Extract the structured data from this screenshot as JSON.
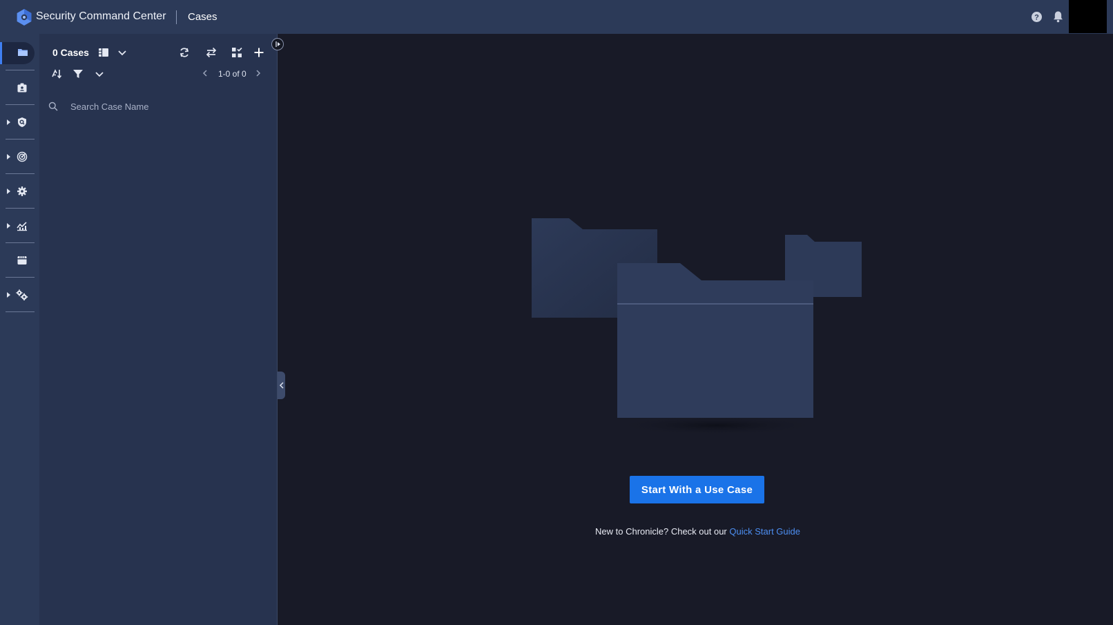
{
  "app": {
    "brand": "Security Command Center",
    "page_title": "Cases"
  },
  "header": {
    "icons": [
      "help-icon",
      "bell-icon"
    ]
  },
  "sidebar": {
    "items": [
      {
        "icon": "folder-icon",
        "active": true,
        "expandable": false
      },
      {
        "icon": "case-badge-icon",
        "active": false,
        "expandable": false
      },
      {
        "icon": "shield-search-icon",
        "active": false,
        "expandable": true
      },
      {
        "icon": "radar-icon",
        "active": false,
        "expandable": true
      },
      {
        "icon": "gear-icon",
        "active": false,
        "expandable": true
      },
      {
        "icon": "analytics-icon",
        "active": false,
        "expandable": true
      },
      {
        "icon": "store-icon",
        "active": false,
        "expandable": false
      },
      {
        "icon": "settings-gears-icon",
        "active": false,
        "expandable": true
      }
    ]
  },
  "cases_panel": {
    "count_label": "0 Cases",
    "pagination": "1-0 of 0",
    "search_placeholder": "Search Case Name"
  },
  "empty_state": {
    "cta_label": "Start With a Use Case",
    "help_text": "New to Chronicle? Check out our",
    "help_link": "Quick Start Guide"
  },
  "colors": {
    "topbar": "#2c3a58",
    "panel": "#27334f",
    "background": "#181a27",
    "accent": "#1a73e8",
    "link": "#4d8ff2"
  }
}
